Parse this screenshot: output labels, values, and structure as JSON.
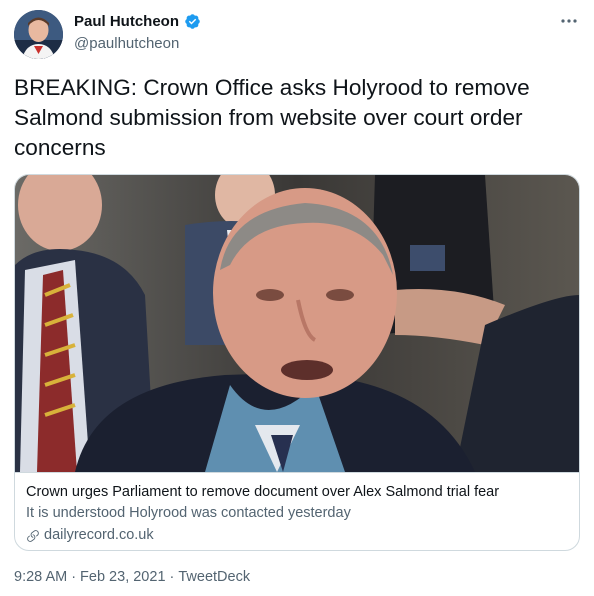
{
  "author": {
    "name": "Paul Hutcheon",
    "handle": "@paulhutcheon",
    "verified": true,
    "verified_color": "#1d9bf0"
  },
  "tweet": {
    "text": "BREAKING: Crown Office asks Holyrood to remove Salmond submission from website over court order concerns"
  },
  "card": {
    "title": "Crown urges Parliament to remove document over Alex Salmond trial fear",
    "description": "It is understood Holyrood was contacted yesterday",
    "domain": "dailyrecord.co.uk",
    "image_icon": "news-photo"
  },
  "meta": {
    "time": "9:28 AM",
    "separator1": "·",
    "date": "Feb 23, 2021",
    "separator2": "·",
    "source": "TweetDeck"
  },
  "icons": {
    "more": "more-horizontal-icon",
    "verified": "verified-badge-icon",
    "link": "link-icon"
  },
  "colors": {
    "text_primary": "#0f1419",
    "text_secondary": "#536471",
    "border": "#cfd9de"
  }
}
